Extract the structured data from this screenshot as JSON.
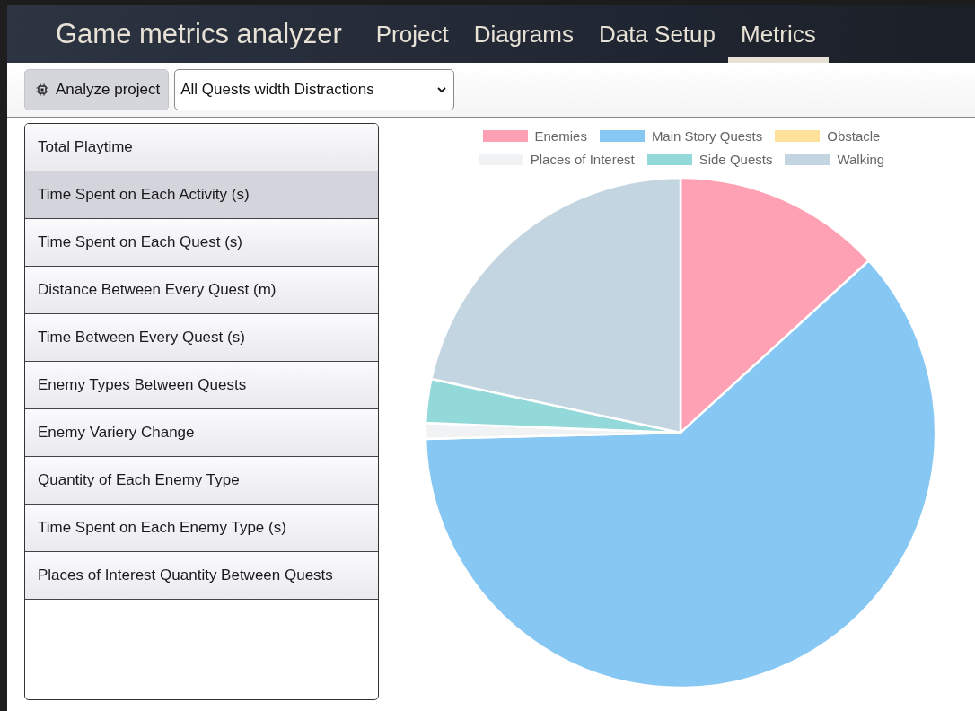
{
  "header": {
    "title": "Game metrics analyzer",
    "tabs": [
      {
        "label": "Project",
        "selected": false
      },
      {
        "label": "Diagrams",
        "selected": false
      },
      {
        "label": "Data Setup",
        "selected": false
      },
      {
        "label": "Metrics",
        "selected": true
      }
    ]
  },
  "toolbar": {
    "analyze_button": "Analyze project",
    "dataset_select": "All Quests width Distractions"
  },
  "metrics": [
    {
      "label": "Total Playtime",
      "selected": false
    },
    {
      "label": "Time Spent on Each Activity (s)",
      "selected": true
    },
    {
      "label": "Time Spent on Each Quest (s)",
      "selected": false
    },
    {
      "label": "Distance Between Every Quest (m)",
      "selected": false
    },
    {
      "label": "Time Between Every Quest (s)",
      "selected": false
    },
    {
      "label": "Enemy Types Between Quests",
      "selected": false
    },
    {
      "label": "Enemy Variery Change",
      "selected": false
    },
    {
      "label": "Quantity of Each Enemy Type",
      "selected": false
    },
    {
      "label": "Time Spent on Each Enemy Type (s)",
      "selected": false
    },
    {
      "label": "Places of Interest Quantity Between Quests",
      "selected": false
    }
  ],
  "legend": [
    {
      "label": "Enemies",
      "color": "#ffa1b5"
    },
    {
      "label": "Main Story Quests",
      "color": "#86c7f3"
    },
    {
      "label": "Obstacle",
      "color": "#ffe29a"
    },
    {
      "label": "Places of Interest",
      "color": "#f1f2f4"
    },
    {
      "label": "Side Quests",
      "color": "#93d9d9"
    },
    {
      "label": "Walking",
      "color": "#c3d5e0"
    }
  ]
}
